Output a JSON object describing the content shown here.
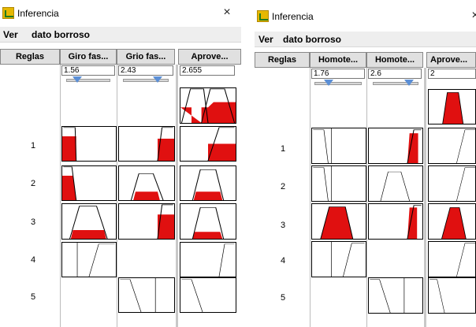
{
  "windows": [
    {
      "title": "Inferencia",
      "close_glyph": "×",
      "menu": [
        "Ver",
        "dato borroso"
      ],
      "headers": [
        "Reglas",
        "Giro fas...",
        "Grio fas...",
        "Aprove..."
      ],
      "inputs": [
        "1.56",
        "2.43",
        "2.655"
      ],
      "slider_positions": [
        0.25,
        0.75
      ],
      "rule_labels": [
        "1",
        "2",
        "3",
        "4",
        "5"
      ]
    },
    {
      "title": "Inferencia",
      "close_glyph": "×",
      "menu": [
        "Ver",
        "dato borroso"
      ],
      "headers": [
        "Reglas",
        "Homote...",
        "Homote...",
        "Aprove..."
      ],
      "inputs": [
        "1.76",
        "2.6",
        "2"
      ],
      "slider_positions": [
        0.3,
        0.8
      ],
      "rule_labels": [
        "1",
        "2",
        "3",
        "4",
        "5"
      ]
    }
  ],
  "colors": {
    "fill": "#e01010",
    "window_bg": "#ffffff",
    "header_bg": "#e0e0e0",
    "slider_knob": "#5b8fd6"
  },
  "icons": [
    "app-icon",
    "close-icon",
    "slider-knob-icon"
  ]
}
